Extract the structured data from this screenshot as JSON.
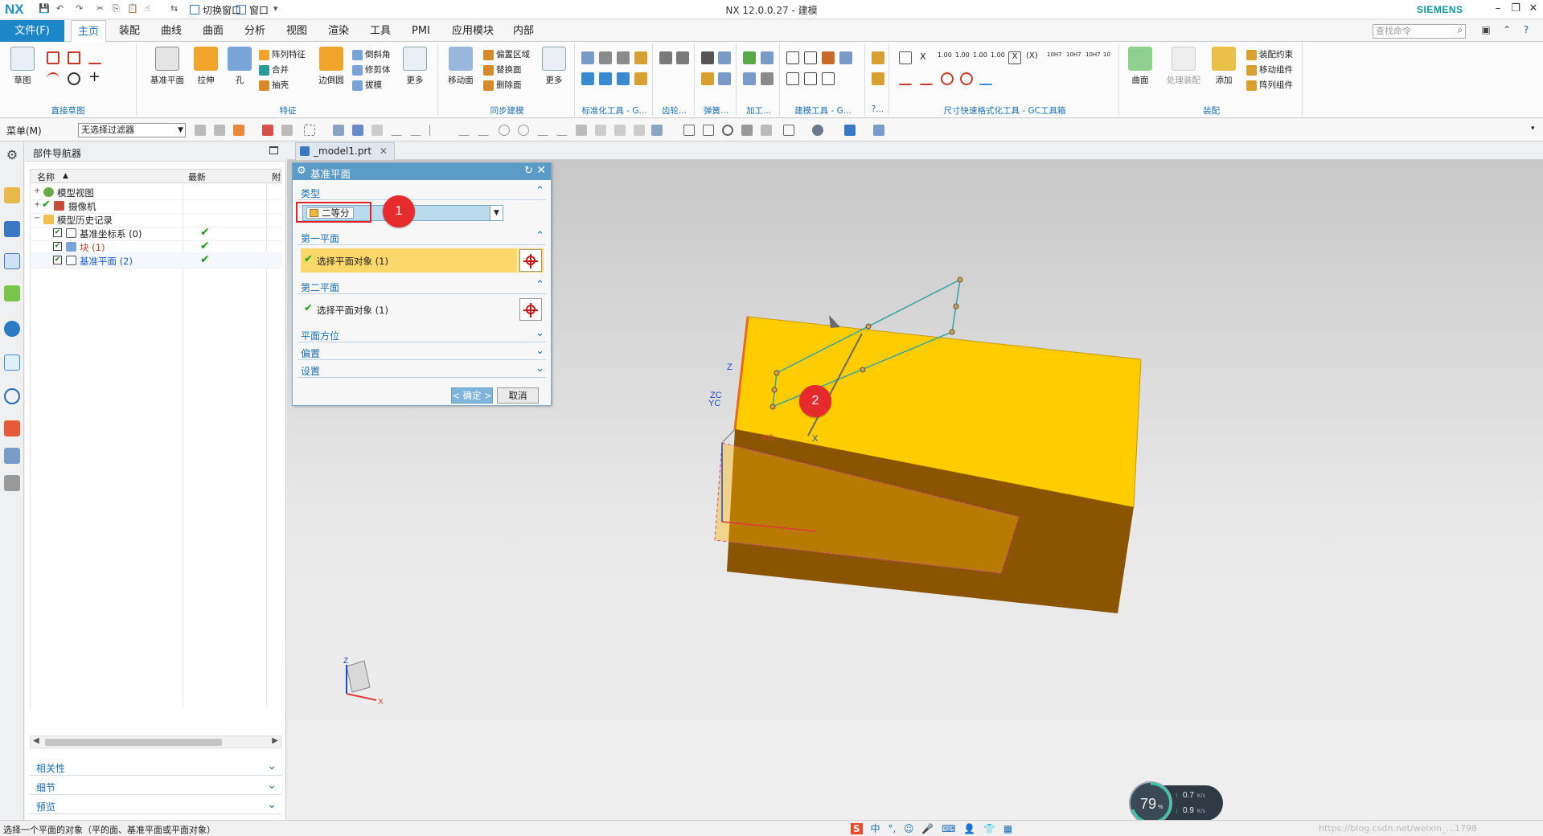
{
  "app": {
    "logo": "NX",
    "window_title": "NX 12.0.0.27 - 建模",
    "brand": "SIEMENS",
    "quick_switch_window": "切换窗口",
    "quick_window": "窗口"
  },
  "ribbon_tabs": {
    "file": "文件(F)",
    "items": [
      "主页",
      "装配",
      "曲线",
      "曲面",
      "分析",
      "视图",
      "渲染",
      "工具",
      "PMI",
      "应用模块",
      "内部"
    ],
    "active": "主页",
    "search_placeholder": "查找命令"
  },
  "ribbon": {
    "sketch": "草图",
    "datum_plane": "基准平面",
    "extrude": "拉伸",
    "hole": "孔",
    "pattern_feature": "阵列特征",
    "unite": "合并",
    "shell": "抽壳",
    "edge_blend": "边倒圆",
    "chamfer": "倒斜角",
    "trim_body": "修剪体",
    "draft": "拔模",
    "more1": "更多",
    "move_face": "移动面",
    "offset_region": "偏置区域",
    "replace_face": "替换面",
    "delete_face": "删除面",
    "more2": "更多",
    "surface": "曲面",
    "process_assembly": "处理装配",
    "add": "添加",
    "assembly_constraints": "装配约束",
    "move_component": "移动组件",
    "pattern_component": "阵列组件",
    "groups": {
      "direct_sketch": "直接草图",
      "feature": "特征",
      "sync_modeling": "同步建模",
      "std_tools": "标准化工具 - G...",
      "gear": "齿轮...",
      "spring": "弹簧...",
      "machining": "加工...",
      "modeling_tools": "建模工具 - G...",
      "q": "?...",
      "dimension_tools": "尺寸快速格式化工具 - GC工具箱",
      "assembly": "装配"
    }
  },
  "command_bar": {
    "menu": "菜单(M)",
    "filter": "无选择过滤器"
  },
  "part_navigator": {
    "title": "部件导航器",
    "col_name": "名称",
    "col_latest": "最新",
    "col_extra": "附",
    "rows": [
      {
        "label": "模型视图",
        "color": "#222222"
      },
      {
        "label": "摄像机",
        "color": "#222222"
      },
      {
        "label": "模型历史记录",
        "color": "#222222"
      },
      {
        "label": "基准坐标系 (0)",
        "color": "#222222"
      },
      {
        "label": "块 (1)",
        "color": "#d0392b"
      },
      {
        "label": "基准平面 (2)",
        "color": "#1c5fd0"
      }
    ],
    "sections": [
      "相关性",
      "细节",
      "预览"
    ]
  },
  "document_tab": "_model1.prt",
  "dialog": {
    "title": "基准平面",
    "type_section": "类型",
    "type_value": "二等分",
    "first_plane": "第一平面",
    "first_select": "选择平面对象 (1)",
    "second_plane": "第二平面",
    "second_select": "选择平面对象 (1)",
    "plane_orientation": "平面方位",
    "offset": "偏置",
    "settings": "设置",
    "ok": "< 确定 >",
    "cancel": "取消"
  },
  "markers": [
    "1",
    "2"
  ],
  "triad_labels": {
    "z": "Z",
    "x": "X",
    "xc": "XC",
    "zc": "ZC",
    "yc": "YC"
  },
  "speed_widget": {
    "percent": "79",
    "unit": "%",
    "up": "0.7",
    "down": "0.9",
    "rate_unit": "K/s"
  },
  "status_bar": {
    "message": "选择一个平面的对象（平的面、基准平面或平面对象）",
    "ime_items": [
      "S",
      "中",
      "°,",
      "☺",
      "🎤",
      "⌨",
      "👤",
      "👕",
      "▦"
    ],
    "watermark": "https://blog.csdn.net/weixin_...1798"
  }
}
